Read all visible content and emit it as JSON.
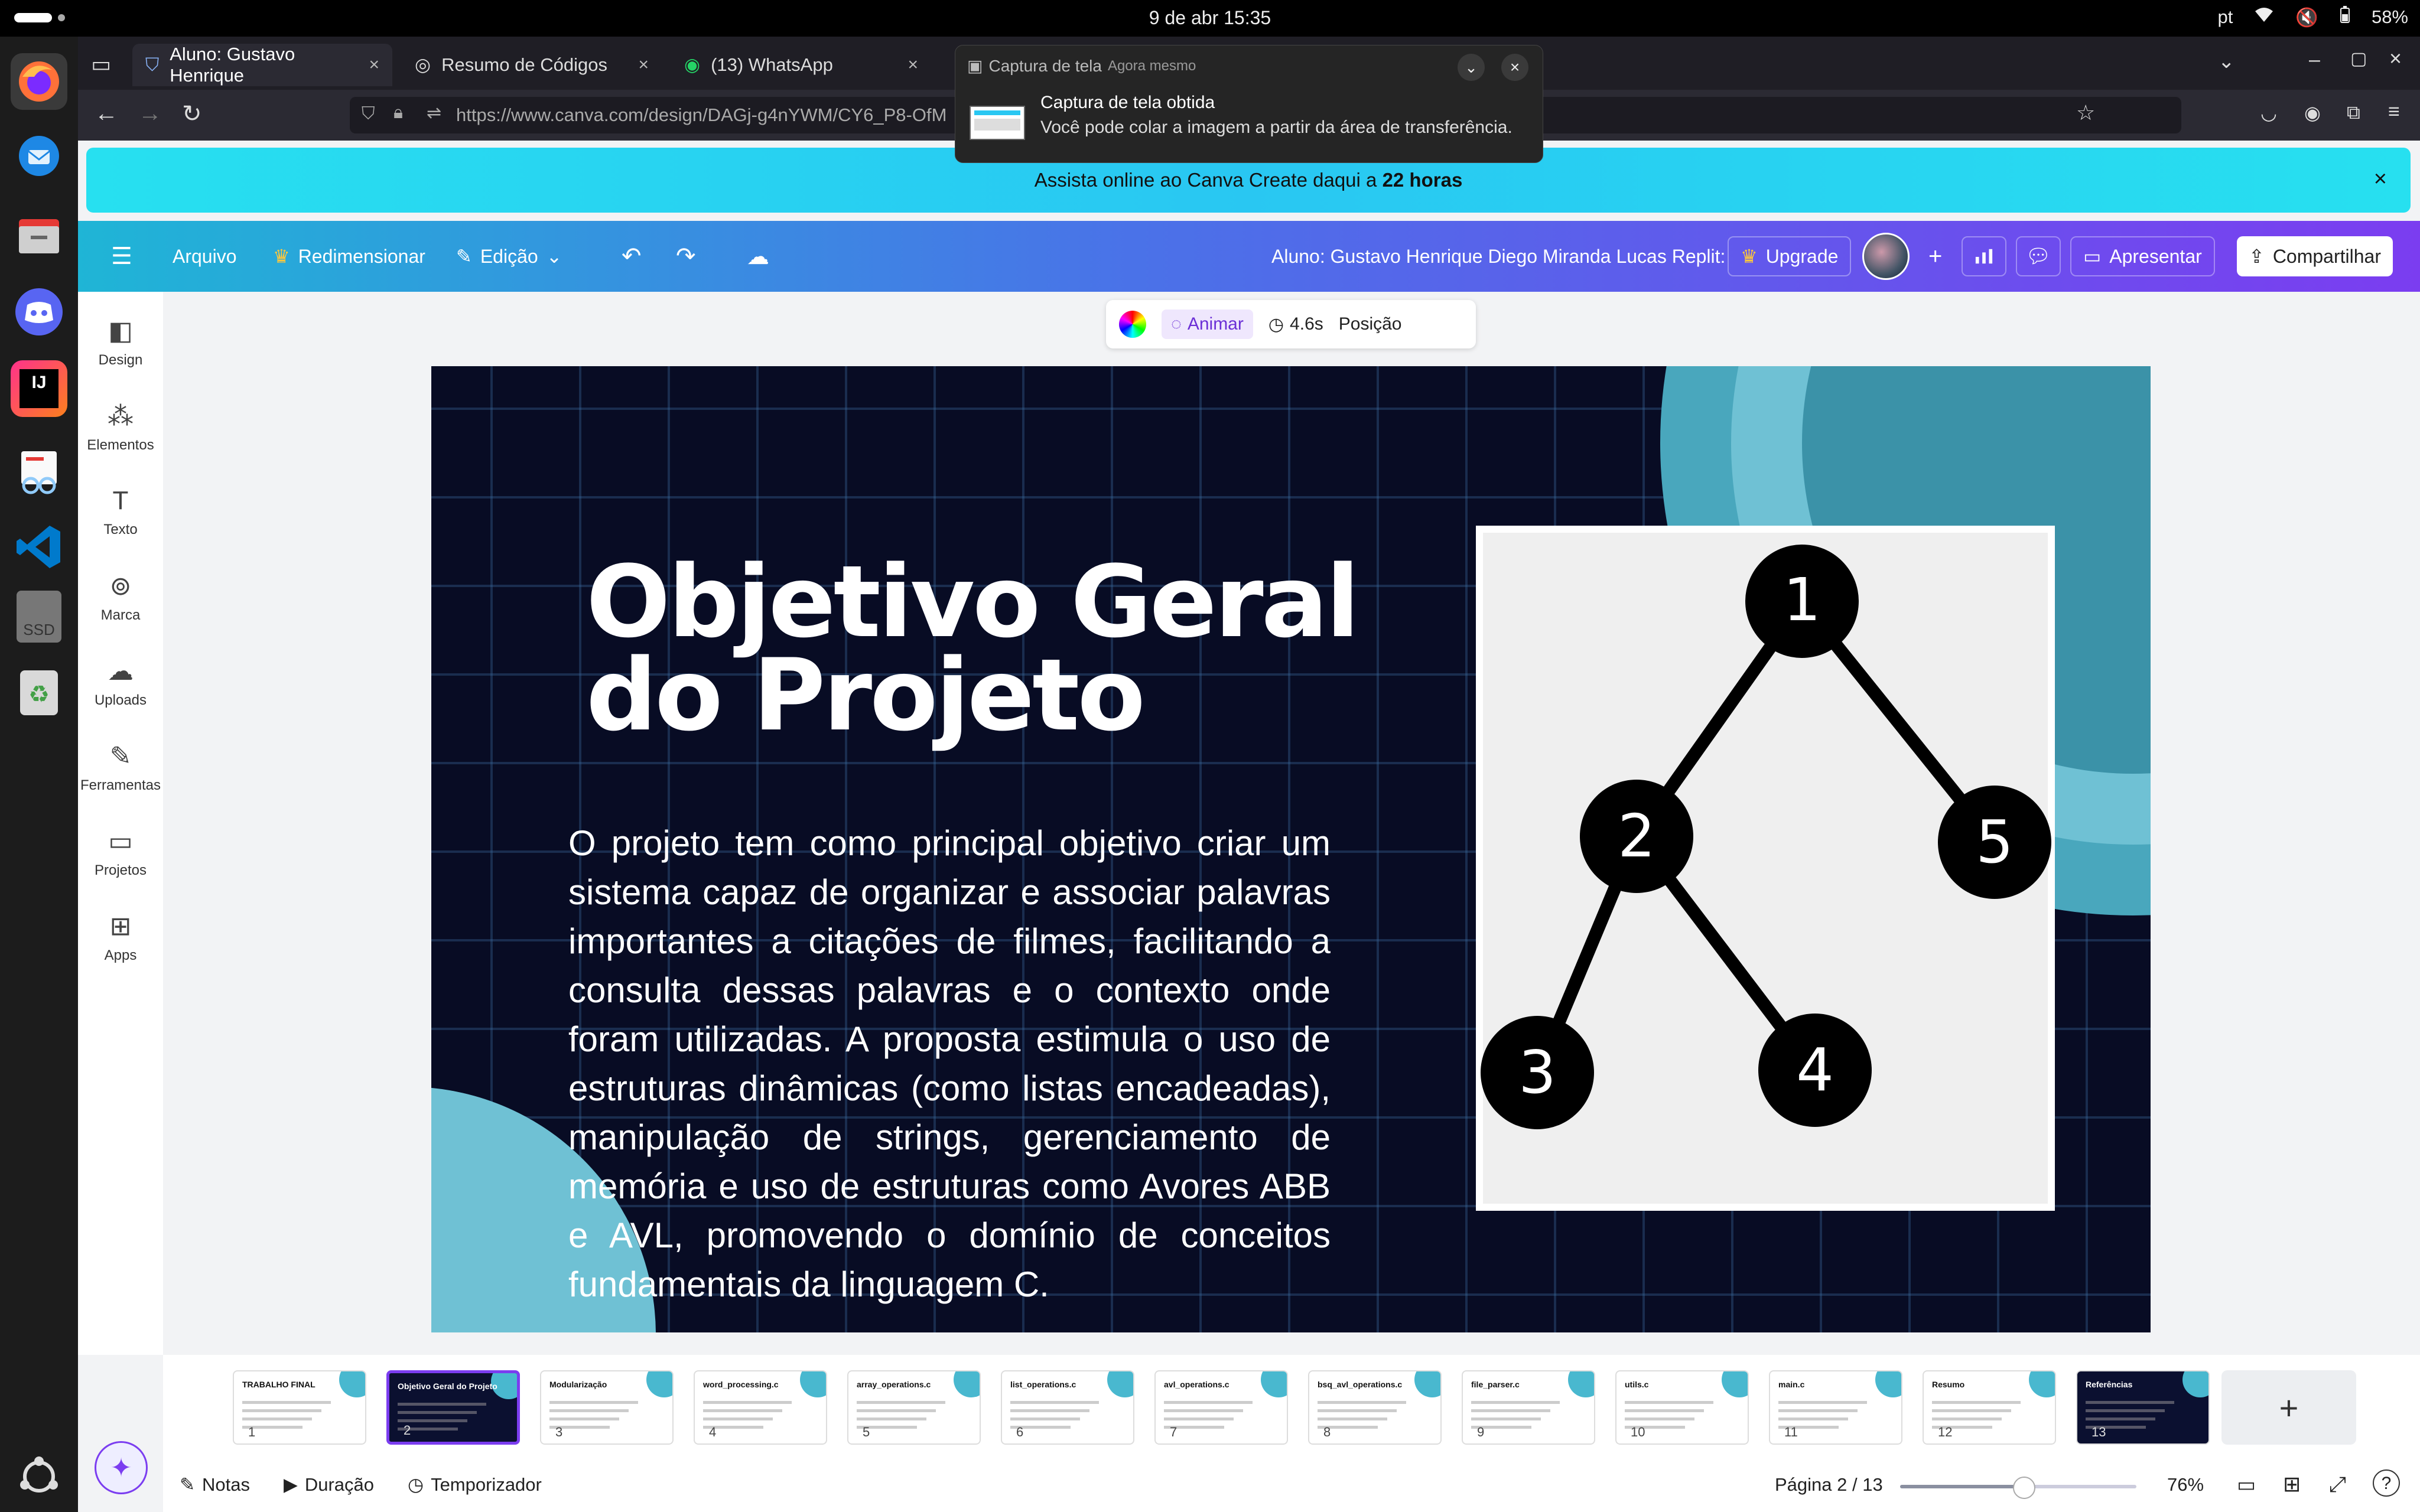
{
  "system": {
    "clock": "9 de abr  15:35",
    "lang": "pt",
    "battery": "58%"
  },
  "dock": {
    "items": [
      "firefox-icon",
      "thunderbird-icon",
      "files-icon",
      "discord-icon",
      "intellij-icon",
      "document-viewer-icon",
      "vscode-icon",
      "ssd-drive-icon",
      "trash-icon",
      "apps-grid-icon"
    ],
    "ssd_label": "SSD",
    "intellij_label": "IJ"
  },
  "browser": {
    "tabs": [
      {
        "label": "Aluno: Gustavo Henrique",
        "active": true
      },
      {
        "label": "Resumo de Códigos",
        "active": false
      },
      {
        "label": "(13) WhatsApp",
        "active": false
      }
    ],
    "url": "https://www.canva.com/design/DAGj-g4nYWM/CY6_P8-OfM"
  },
  "notification": {
    "app": "Captura de tela",
    "time": "Agora mesmo",
    "title": "Captura de tela obtida",
    "body": "Você pode colar a imagem a partir da área de transferência."
  },
  "banner": {
    "text": "Assista online ao Canva Create daqui a ",
    "highlight": "22 horas"
  },
  "header": {
    "file": "Arquivo",
    "resize": "Redimensionar",
    "edit": "Edição",
    "doc_title": "Aluno: Gustavo Henrique Diego Miranda Lucas Replit:",
    "upgrade": "Upgrade",
    "present": "Apresentar",
    "share": "Compartilhar"
  },
  "sidebar": {
    "items": [
      {
        "label": "Design",
        "icon": "design-icon"
      },
      {
        "label": "Elementos",
        "icon": "elements-icon"
      },
      {
        "label": "Texto",
        "icon": "text-icon"
      },
      {
        "label": "Marca",
        "icon": "brand-icon"
      },
      {
        "label": "Uploads",
        "icon": "upload-icon"
      },
      {
        "label": "Ferramentas",
        "icon": "tools-icon"
      },
      {
        "label": "Projetos",
        "icon": "folder-icon"
      },
      {
        "label": "Apps",
        "icon": "apps-icon"
      }
    ]
  },
  "toolbar": {
    "animate": "Animar",
    "duration": "4.6s",
    "position": "Posição"
  },
  "slide": {
    "title_line1": "Objetivo Geral",
    "title_line2": "do Projeto",
    "body": "O projeto tem como principal objetivo criar um sistema capaz de organizar e associar palavras importantes a citações de filmes, facilitando a consulta dessas palavras e o contexto onde foram utilizadas. A proposta estimula o uso de estruturas dinâmicas (como listas encadeadas), manipulação de strings, gerenciamento de memória e uso de estruturas como Avores ABB e AVL, promovendo o domínio de conceitos fundamentais da linguagem C.",
    "tree_nodes": [
      "1",
      "2",
      "5",
      "3",
      "4"
    ]
  },
  "thumbnails": [
    {
      "num": "1",
      "title": "TRABALHO FINAL",
      "dark": false
    },
    {
      "num": "2",
      "title": "Objetivo Geral do Projeto",
      "dark": true
    },
    {
      "num": "3",
      "title": "Modularização",
      "dark": false
    },
    {
      "num": "4",
      "title": "word_processing.c",
      "dark": false
    },
    {
      "num": "5",
      "title": "array_operations.c",
      "dark": false
    },
    {
      "num": "6",
      "title": "list_operations.c",
      "dark": false
    },
    {
      "num": "7",
      "title": "avl_operations.c",
      "dark": false
    },
    {
      "num": "8",
      "title": "bsq_avl_operations.c",
      "dark": false
    },
    {
      "num": "9",
      "title": "file_parser.c",
      "dark": false
    },
    {
      "num": "10",
      "title": "utils.c",
      "dark": false
    },
    {
      "num": "11",
      "title": "main.c",
      "dark": false
    },
    {
      "num": "12",
      "title": "Resumo",
      "dark": false
    },
    {
      "num": "13",
      "title": "Referências",
      "dark": true
    }
  ],
  "bottom": {
    "notes": "Notas",
    "duration": "Duração",
    "timer": "Temporizador",
    "page": "Página 2 / 13",
    "zoom": "76%",
    "zoom_fraction": 0.52
  }
}
